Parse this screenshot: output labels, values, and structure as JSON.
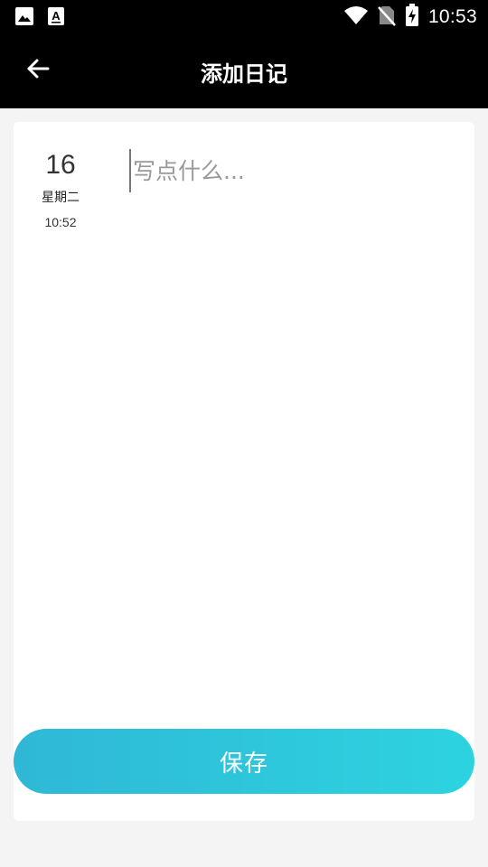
{
  "status_bar": {
    "time": "10:53",
    "icons_left": [
      "image-icon",
      "text-a-icon"
    ],
    "icons_right": [
      "wifi-icon",
      "no-sim-icon",
      "battery-charging-icon"
    ]
  },
  "app_bar": {
    "title": "添加日记",
    "back_icon": "arrow-left-icon"
  },
  "entry": {
    "day": "16",
    "weekday": "星期二",
    "time": "10:52",
    "content_value": "",
    "content_placeholder": "写点什么..."
  },
  "actions": {
    "save_label": "保存"
  },
  "colors": {
    "bar_background": "#000000",
    "page_background": "#f4f4f4",
    "card_background": "#ffffff",
    "button_gradient_start": "#2fb8d6",
    "button_gradient_end": "#2dd3e0"
  }
}
